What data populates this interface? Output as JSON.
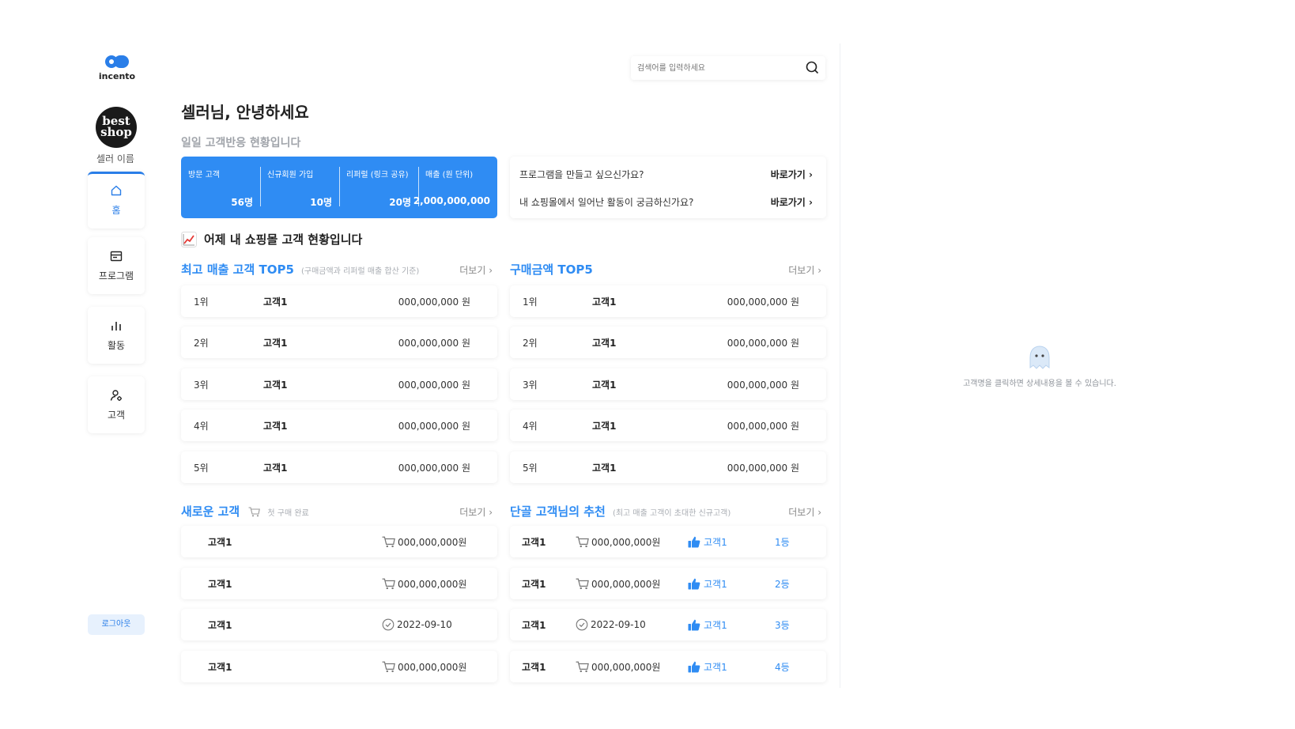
{
  "brand": {
    "name": "incento"
  },
  "seller": {
    "avatar_text": "best shop",
    "name": "셀러 이름"
  },
  "nav": {
    "items": [
      {
        "label": "홈",
        "icon": "home-icon",
        "active": true
      },
      {
        "label": "프로그램",
        "icon": "program-icon",
        "active": false
      },
      {
        "label": "활동",
        "icon": "bar-chart-icon",
        "active": false
      },
      {
        "label": "고객",
        "icon": "customer-icon",
        "active": false
      }
    ],
    "logout_label": "로그아웃"
  },
  "search": {
    "placeholder": "검색어를 입력하세요"
  },
  "header": {
    "greeting": "셀러님, 안녕하세요",
    "subtitle": "일일 고객반응 현황입니다"
  },
  "stats": [
    {
      "label": "방문 고객",
      "value": "56명"
    },
    {
      "label": "신규회원 가입",
      "value": "10명"
    },
    {
      "label": "리퍼럴 (링크 공유)",
      "value": "20명"
    },
    {
      "label": "매출 (원 단위)",
      "value": "2,000,000,000"
    }
  ],
  "promo": [
    {
      "text": "프로그램을 만들고 싶으신가요?",
      "link": "바로가기"
    },
    {
      "text": "내 쇼핑몰에서 일어난 활동이 궁금하신가요?",
      "link": "바로가기"
    }
  ],
  "yesterday_title": "어제 내 쇼핑몰 고객 현황입니다",
  "more_label": "더보기",
  "top_sales": {
    "title": "최고 매출 고객 TOP5",
    "note": "(구매금액과 리퍼럴 매출 합산 기준)",
    "rows": [
      {
        "rank": "1위",
        "name": "고객1",
        "amount": "000,000,000 원"
      },
      {
        "rank": "2위",
        "name": "고객1",
        "amount": "000,000,000 원"
      },
      {
        "rank": "3위",
        "name": "고객1",
        "amount": "000,000,000 원"
      },
      {
        "rank": "4위",
        "name": "고객1",
        "amount": "000,000,000 원"
      },
      {
        "rank": "5위",
        "name": "고객1",
        "amount": "000,000,000 원"
      }
    ]
  },
  "top_purchase": {
    "title": "구매금액 TOP5",
    "rows": [
      {
        "rank": "1위",
        "name": "고객1",
        "amount": "000,000,000 원"
      },
      {
        "rank": "2위",
        "name": "고객1",
        "amount": "000,000,000 원"
      },
      {
        "rank": "3위",
        "name": "고객1",
        "amount": "000,000,000 원"
      },
      {
        "rank": "4위",
        "name": "고객1",
        "amount": "000,000,000 원"
      },
      {
        "rank": "5위",
        "name": "고객1",
        "amount": "000,000,000 원"
      }
    ]
  },
  "new_customers": {
    "title": "새로운 고객",
    "note": "첫 구매 완료",
    "rows": [
      {
        "name": "고객1",
        "icon": "cart-icon",
        "value": "000,000,000원"
      },
      {
        "name": "고객1",
        "icon": "cart-icon",
        "value": "000,000,000원"
      },
      {
        "name": "고객1",
        "icon": "check-circle-icon",
        "value": "2022-09-10"
      },
      {
        "name": "고객1",
        "icon": "cart-icon",
        "value": "000,000,000원"
      }
    ]
  },
  "referrals": {
    "title": "단골 고객님의 추천",
    "note": "(최고 매출 고객이 초대한 신규고객)",
    "rows": [
      {
        "name": "고객1",
        "icon": "cart-icon",
        "value": "000,000,000원",
        "referrer": "고객1",
        "rank": "1등"
      },
      {
        "name": "고객1",
        "icon": "cart-icon",
        "value": "000,000,000원",
        "referrer": "고객1",
        "rank": "2등"
      },
      {
        "name": "고객1",
        "icon": "check-circle-icon",
        "value": "2022-09-10",
        "referrer": "고객1",
        "rank": "3등"
      },
      {
        "name": "고객1",
        "icon": "cart-icon",
        "value": "000,000,000원",
        "referrer": "고객1",
        "rank": "4등"
      }
    ]
  },
  "empty_state": {
    "text": "고객명을 클릭하면 상세내용을 볼 수 있습니다."
  },
  "colors": {
    "accent": "#2f8cf3",
    "brand": "#2a7ee8",
    "logout_bg": "#e7f1fd"
  }
}
